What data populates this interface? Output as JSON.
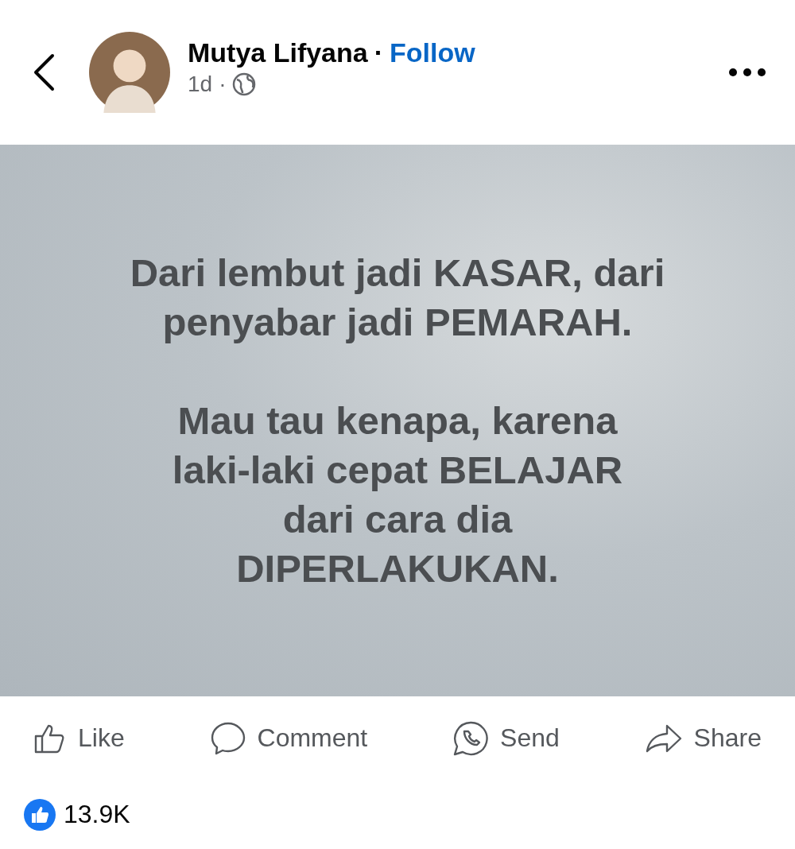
{
  "header": {
    "author": "Mutya Lifyana",
    "separator": "·",
    "follow": "Follow",
    "time": "1d",
    "time_separator": "·"
  },
  "post": {
    "paragraphs": [
      [
        "Dari lembut jadi KASAR, dari",
        "penyabar jadi PEMARAH."
      ],
      [
        "Mau tau kenapa, karena",
        "laki-laki cepat BELAJAR",
        "dari cara dia",
        "DIPERLAKUKAN."
      ]
    ]
  },
  "actions": [
    {
      "kind": "like",
      "label": "Like"
    },
    {
      "kind": "comment",
      "label": "Comment"
    },
    {
      "kind": "send",
      "label": "Send"
    },
    {
      "kind": "share",
      "label": "Share"
    }
  ],
  "reactions": {
    "count": "13.9K"
  }
}
